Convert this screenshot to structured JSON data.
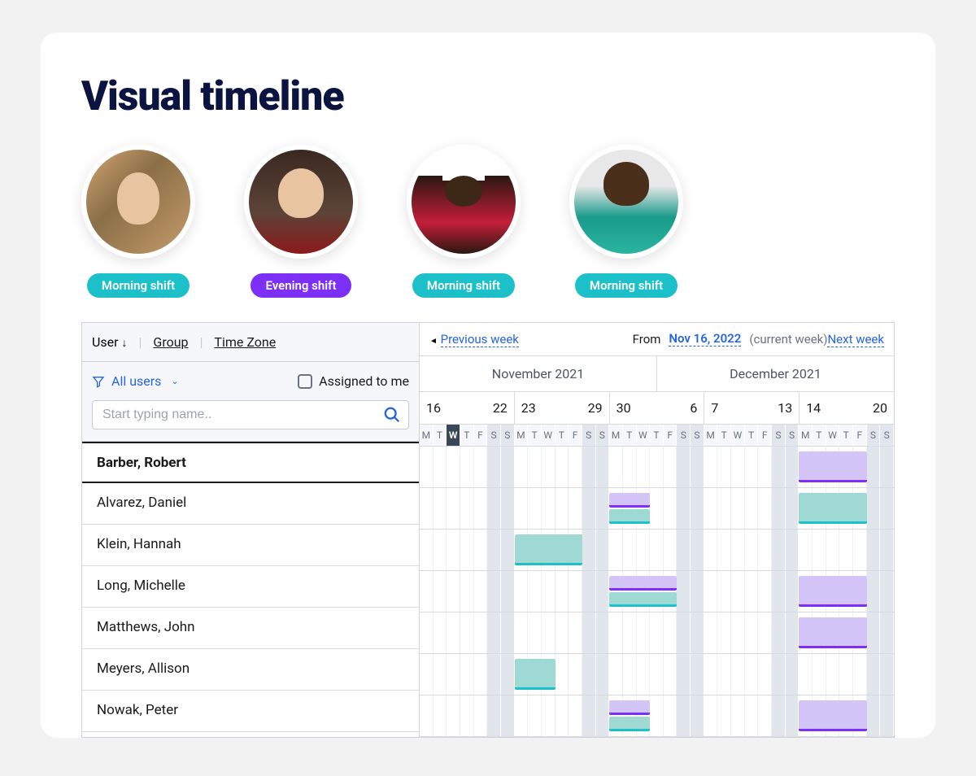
{
  "title": "Visual timeline",
  "avatars": [
    {
      "shift": "Morning shift",
      "shift_type": "morning"
    },
    {
      "shift": "Evening shift",
      "shift_type": "evening"
    },
    {
      "shift": "Morning shift",
      "shift_type": "morning"
    },
    {
      "shift": "Morning shift",
      "shift_type": "morning"
    }
  ],
  "controls": {
    "user_label": "User",
    "group_label": "Group",
    "timezone_label": "Time Zone",
    "filter_label": "All users",
    "assigned_label": "Assigned to me",
    "search_placeholder": "Start typing name.."
  },
  "nav": {
    "prev": "Previous week",
    "from_label": "From",
    "from_date": "Nov 16, 2022",
    "current": "(current week)",
    "next": "Next week"
  },
  "months": [
    "November 2021",
    "December 2021"
  ],
  "weeks": [
    {
      "start": "16",
      "end": "22"
    },
    {
      "start": "23",
      "end": "29"
    },
    {
      "start": "30",
      "end": "6"
    },
    {
      "start": "7",
      "end": "13"
    },
    {
      "start": "14",
      "end": "20"
    }
  ],
  "days": [
    "M",
    "T",
    "W",
    "T",
    "F",
    "S",
    "S"
  ],
  "users": [
    {
      "name": "Barber, Robert",
      "selected": true,
      "bars": [
        {
          "start": 28,
          "span": 5,
          "cls": "bar-purple"
        }
      ]
    },
    {
      "name": "Alvarez, Daniel",
      "bars": [
        {
          "start": 14,
          "span": 3,
          "cls": "bar-purple bar-half top"
        },
        {
          "start": 14,
          "span": 3,
          "cls": "bar-teal bar-half bot"
        },
        {
          "start": 28,
          "span": 5,
          "cls": "bar-teal"
        }
      ]
    },
    {
      "name": "Klein, Hannah",
      "bars": [
        {
          "start": 7,
          "span": 5,
          "cls": "bar-teal"
        }
      ]
    },
    {
      "name": "Long, Michelle",
      "bars": [
        {
          "start": 14,
          "span": 5,
          "cls": "bar-purple bar-half top"
        },
        {
          "start": 14,
          "span": 5,
          "cls": "bar-teal bar-half bot"
        },
        {
          "start": 28,
          "span": 5,
          "cls": "bar-purple"
        }
      ]
    },
    {
      "name": "Matthews, John",
      "bars": [
        {
          "start": 28,
          "span": 5,
          "cls": "bar-purple"
        }
      ]
    },
    {
      "name": "Meyers, Allison",
      "bars": [
        {
          "start": 7,
          "span": 3,
          "cls": "bar-teal"
        }
      ]
    },
    {
      "name": "Nowak, Peter",
      "bars": [
        {
          "start": 14,
          "span": 3,
          "cls": "bar-purple bar-half top"
        },
        {
          "start": 14,
          "span": 3,
          "cls": "bar-teal bar-half bot"
        },
        {
          "start": 28,
          "span": 5,
          "cls": "bar-purple"
        }
      ]
    }
  ]
}
